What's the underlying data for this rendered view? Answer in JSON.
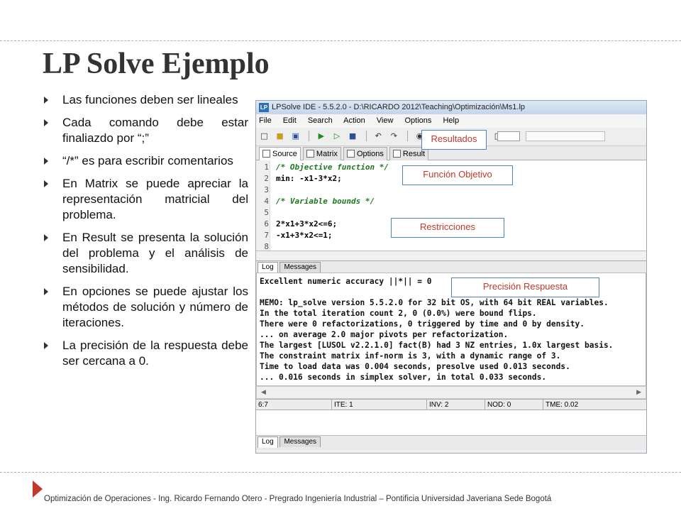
{
  "slide": {
    "title": "LP Solve Ejemplo",
    "footer": "Optimización de Operaciones -  Ing. Ricardo Fernando Otero  -  Pregrado Ingeniería Industrial – Pontificia Universidad Javeriana Sede Bogotá"
  },
  "bullets": [
    "Las funciones deben ser lineales",
    "Cada comando debe estar finaliazdo por “;”",
    "“/*” es para escribir comentarios",
    "En Matrix se puede apreciar la representación matricial del problema.",
    "En Result se presenta la solución del problema y el análisis de sensibilidad.",
    "En opciones se puede ajustar los métodos de solución y número de iteraciones.",
    "La precisión de la respuesta debe ser cercana a 0."
  ],
  "ide": {
    "window_title": "LPSolve IDE - 5.5.2.0 - D:\\RICARDO 2012\\Teaching\\Optimización\\Ms1.lp",
    "app_icon": "LP",
    "menu": [
      "File",
      "Edit",
      "Search",
      "Action",
      "View",
      "Options",
      "Help"
    ],
    "toolbar_icons": [
      "new-file-icon",
      "open-folder-icon",
      "save-icon",
      "run-icon",
      "step-icon",
      "stop-icon",
      "undo-icon",
      "redo-icon",
      "binoculars-icon",
      "find-icon",
      "replace-icon",
      "cut-icon",
      "copy-icon",
      "paste-icon"
    ],
    "tabs": [
      "Source",
      "Matrix",
      "Options",
      "Result"
    ],
    "code": [
      {
        "n": "1",
        "text": "/* Objective function */",
        "type": "comment"
      },
      {
        "n": "2",
        "text": "min: -x1-3*x2;",
        "type": "code"
      },
      {
        "n": "3",
        "text": "",
        "type": "code"
      },
      {
        "n": "4",
        "text": "/* Variable bounds */",
        "type": "comment"
      },
      {
        "n": "5",
        "text": "",
        "type": "code"
      },
      {
        "n": "6",
        "text": "2*x1+3*x2<=6;",
        "type": "code"
      },
      {
        "n": "7",
        "text": "-x1+3*x2<=1;",
        "type": "code"
      },
      {
        "n": "8",
        "text": "",
        "type": "code"
      }
    ],
    "log_tabs": [
      "Log",
      "Messages"
    ],
    "log_lines": [
      "Excellent numeric accuracy ||*|| = 0",
      "",
      "MEMO: lp_solve version 5.5.2.0 for 32 bit OS, with 64 bit REAL variables.",
      "In the total iteration count 2, 0 (0.0%) were bound flips.",
      "There were 0 refactorizations, 0 triggered by time and 0 by density.",
      "... on average 2.0 major pivots per refactorization.",
      "The largest [LUSOL v2.2.1.0] fact(B) had 3 NZ entries, 1.0x largest basis.",
      "The constraint matrix inf-norm is 3, with a dynamic range of 3.",
      "Time to load data was 0.004 seconds, presolve used 0.013 seconds.",
      "... 0.016 seconds in simplex solver, in total 0.033 seconds."
    ],
    "status": {
      "pos": "6:7",
      "ite": "ITE: 1",
      "inv": "INV: 2",
      "nod": "NOD: 0",
      "tme": "TME: 0.02"
    },
    "lower_tabs": [
      "Log",
      "Messages"
    ]
  },
  "callouts": {
    "resultados": "Resultados",
    "funcion_objetivo": "Función Objetivo",
    "restricciones": "Restricciones",
    "precision": "Precisión Respuesta"
  },
  "colors": {
    "accent": "#c0392b",
    "callout_border": "#4a86c6",
    "comment": "#1a7a1a"
  }
}
